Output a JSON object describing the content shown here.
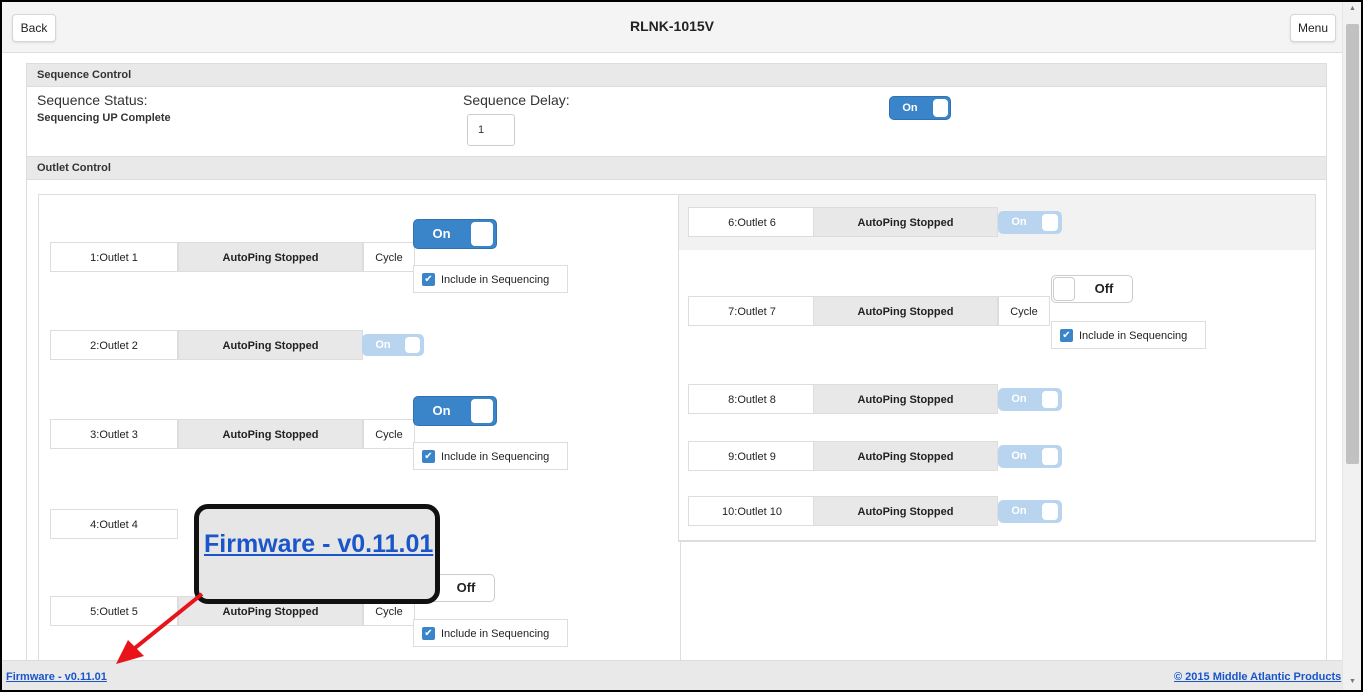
{
  "header": {
    "back_label": "Back",
    "title": "RLNK-1015V",
    "menu_label": "Menu"
  },
  "sequence": {
    "section_label": "Sequence Control",
    "status_label": "Sequence Status:",
    "status_value": "Sequencing UP Complete",
    "delay_label": "Sequence Delay:",
    "delay_value": "1",
    "toggle_label": "On"
  },
  "outlet_section_label": "Outlet Control",
  "outlets_left": [
    {
      "name": "1:Outlet 1",
      "status": "AutoPing Stopped",
      "cycle": "Cycle",
      "toggle": "On",
      "include": "Include in Sequencing"
    },
    {
      "name": "2:Outlet 2",
      "status": "AutoPing Stopped",
      "toggle": "On"
    },
    {
      "name": "3:Outlet 3",
      "status": "AutoPing Stopped",
      "cycle": "Cycle",
      "toggle": "On",
      "include": "Include in Sequencing"
    },
    {
      "name": "4:Outlet 4"
    },
    {
      "name": "5:Outlet 5",
      "status": "AutoPing Stopped",
      "cycle": "Cycle",
      "toggle": "Off",
      "include": "Include in Sequencing"
    }
  ],
  "outlets_right": [
    {
      "name": "6:Outlet 6",
      "status": "AutoPing Stopped",
      "toggle": "On"
    },
    {
      "name": "7:Outlet 7",
      "status": "AutoPing Stopped",
      "cycle": "Cycle",
      "toggle": "Off",
      "include": "Include in Sequencing"
    },
    {
      "name": "8:Outlet 8",
      "status": "AutoPing Stopped",
      "toggle": "On"
    },
    {
      "name": "9:Outlet 9",
      "status": "AutoPing Stopped",
      "toggle": "On"
    },
    {
      "name": "10:Outlet 10",
      "status": "AutoPing Stopped",
      "toggle": "On"
    }
  ],
  "footer": {
    "firmware": "Firmware - v0.11.01",
    "copyright": "© 2015 Middle Atlantic Products"
  },
  "callout": {
    "text": "Firmware - v0.11.01"
  },
  "colors": {
    "accent": "#3a85c9",
    "link": "#1a55c9",
    "arrow": "#e8141a",
    "callout_border": "#111111"
  }
}
